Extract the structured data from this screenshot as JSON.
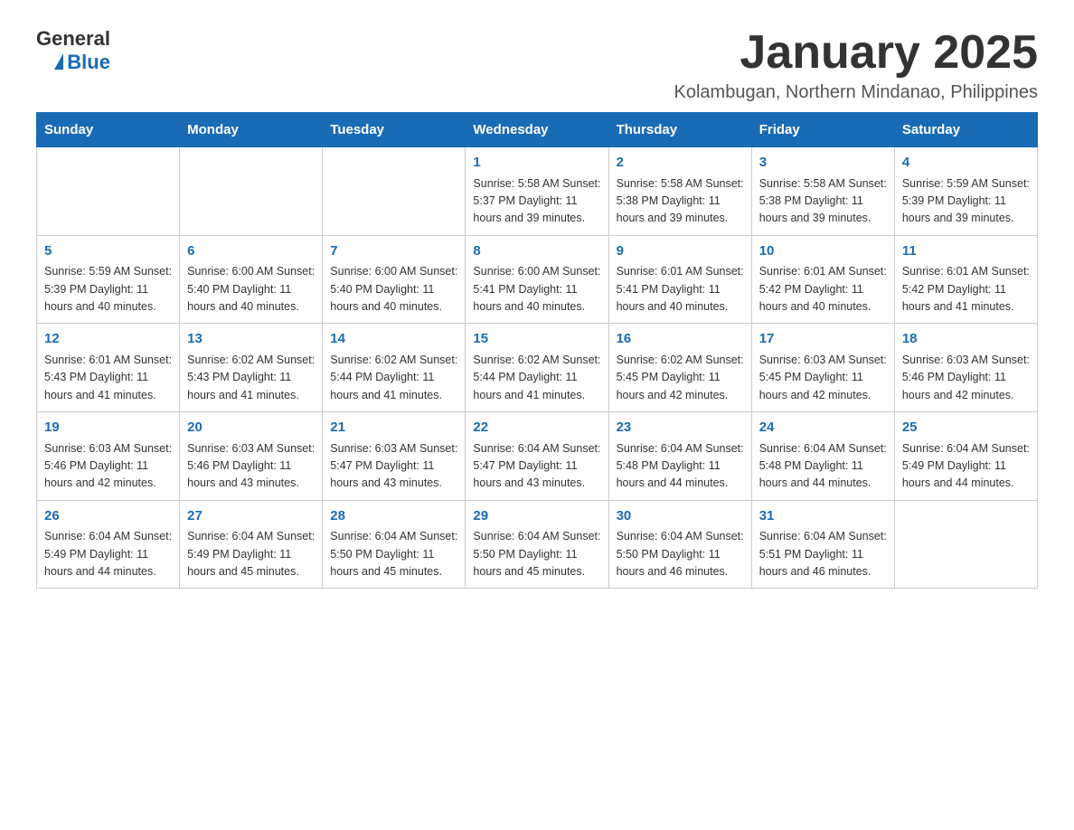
{
  "logo": {
    "text_general": "General",
    "text_blue": "Blue"
  },
  "title": "January 2025",
  "subtitle": "Kolambugan, Northern Mindanao, Philippines",
  "days_of_week": [
    "Sunday",
    "Monday",
    "Tuesday",
    "Wednesday",
    "Thursday",
    "Friday",
    "Saturday"
  ],
  "weeks": [
    [
      {
        "day": "",
        "info": ""
      },
      {
        "day": "",
        "info": ""
      },
      {
        "day": "",
        "info": ""
      },
      {
        "day": "1",
        "info": "Sunrise: 5:58 AM\nSunset: 5:37 PM\nDaylight: 11 hours and 39 minutes."
      },
      {
        "day": "2",
        "info": "Sunrise: 5:58 AM\nSunset: 5:38 PM\nDaylight: 11 hours and 39 minutes."
      },
      {
        "day": "3",
        "info": "Sunrise: 5:58 AM\nSunset: 5:38 PM\nDaylight: 11 hours and 39 minutes."
      },
      {
        "day": "4",
        "info": "Sunrise: 5:59 AM\nSunset: 5:39 PM\nDaylight: 11 hours and 39 minutes."
      }
    ],
    [
      {
        "day": "5",
        "info": "Sunrise: 5:59 AM\nSunset: 5:39 PM\nDaylight: 11 hours and 40 minutes."
      },
      {
        "day": "6",
        "info": "Sunrise: 6:00 AM\nSunset: 5:40 PM\nDaylight: 11 hours and 40 minutes."
      },
      {
        "day": "7",
        "info": "Sunrise: 6:00 AM\nSunset: 5:40 PM\nDaylight: 11 hours and 40 minutes."
      },
      {
        "day": "8",
        "info": "Sunrise: 6:00 AM\nSunset: 5:41 PM\nDaylight: 11 hours and 40 minutes."
      },
      {
        "day": "9",
        "info": "Sunrise: 6:01 AM\nSunset: 5:41 PM\nDaylight: 11 hours and 40 minutes."
      },
      {
        "day": "10",
        "info": "Sunrise: 6:01 AM\nSunset: 5:42 PM\nDaylight: 11 hours and 40 minutes."
      },
      {
        "day": "11",
        "info": "Sunrise: 6:01 AM\nSunset: 5:42 PM\nDaylight: 11 hours and 41 minutes."
      }
    ],
    [
      {
        "day": "12",
        "info": "Sunrise: 6:01 AM\nSunset: 5:43 PM\nDaylight: 11 hours and 41 minutes."
      },
      {
        "day": "13",
        "info": "Sunrise: 6:02 AM\nSunset: 5:43 PM\nDaylight: 11 hours and 41 minutes."
      },
      {
        "day": "14",
        "info": "Sunrise: 6:02 AM\nSunset: 5:44 PM\nDaylight: 11 hours and 41 minutes."
      },
      {
        "day": "15",
        "info": "Sunrise: 6:02 AM\nSunset: 5:44 PM\nDaylight: 11 hours and 41 minutes."
      },
      {
        "day": "16",
        "info": "Sunrise: 6:02 AM\nSunset: 5:45 PM\nDaylight: 11 hours and 42 minutes."
      },
      {
        "day": "17",
        "info": "Sunrise: 6:03 AM\nSunset: 5:45 PM\nDaylight: 11 hours and 42 minutes."
      },
      {
        "day": "18",
        "info": "Sunrise: 6:03 AM\nSunset: 5:46 PM\nDaylight: 11 hours and 42 minutes."
      }
    ],
    [
      {
        "day": "19",
        "info": "Sunrise: 6:03 AM\nSunset: 5:46 PM\nDaylight: 11 hours and 42 minutes."
      },
      {
        "day": "20",
        "info": "Sunrise: 6:03 AM\nSunset: 5:46 PM\nDaylight: 11 hours and 43 minutes."
      },
      {
        "day": "21",
        "info": "Sunrise: 6:03 AM\nSunset: 5:47 PM\nDaylight: 11 hours and 43 minutes."
      },
      {
        "day": "22",
        "info": "Sunrise: 6:04 AM\nSunset: 5:47 PM\nDaylight: 11 hours and 43 minutes."
      },
      {
        "day": "23",
        "info": "Sunrise: 6:04 AM\nSunset: 5:48 PM\nDaylight: 11 hours and 44 minutes."
      },
      {
        "day": "24",
        "info": "Sunrise: 6:04 AM\nSunset: 5:48 PM\nDaylight: 11 hours and 44 minutes."
      },
      {
        "day": "25",
        "info": "Sunrise: 6:04 AM\nSunset: 5:49 PM\nDaylight: 11 hours and 44 minutes."
      }
    ],
    [
      {
        "day": "26",
        "info": "Sunrise: 6:04 AM\nSunset: 5:49 PM\nDaylight: 11 hours and 44 minutes."
      },
      {
        "day": "27",
        "info": "Sunrise: 6:04 AM\nSunset: 5:49 PM\nDaylight: 11 hours and 45 minutes."
      },
      {
        "day": "28",
        "info": "Sunrise: 6:04 AM\nSunset: 5:50 PM\nDaylight: 11 hours and 45 minutes."
      },
      {
        "day": "29",
        "info": "Sunrise: 6:04 AM\nSunset: 5:50 PM\nDaylight: 11 hours and 45 minutes."
      },
      {
        "day": "30",
        "info": "Sunrise: 6:04 AM\nSunset: 5:50 PM\nDaylight: 11 hours and 46 minutes."
      },
      {
        "day": "31",
        "info": "Sunrise: 6:04 AM\nSunset: 5:51 PM\nDaylight: 11 hours and 46 minutes."
      },
      {
        "day": "",
        "info": ""
      }
    ]
  ]
}
